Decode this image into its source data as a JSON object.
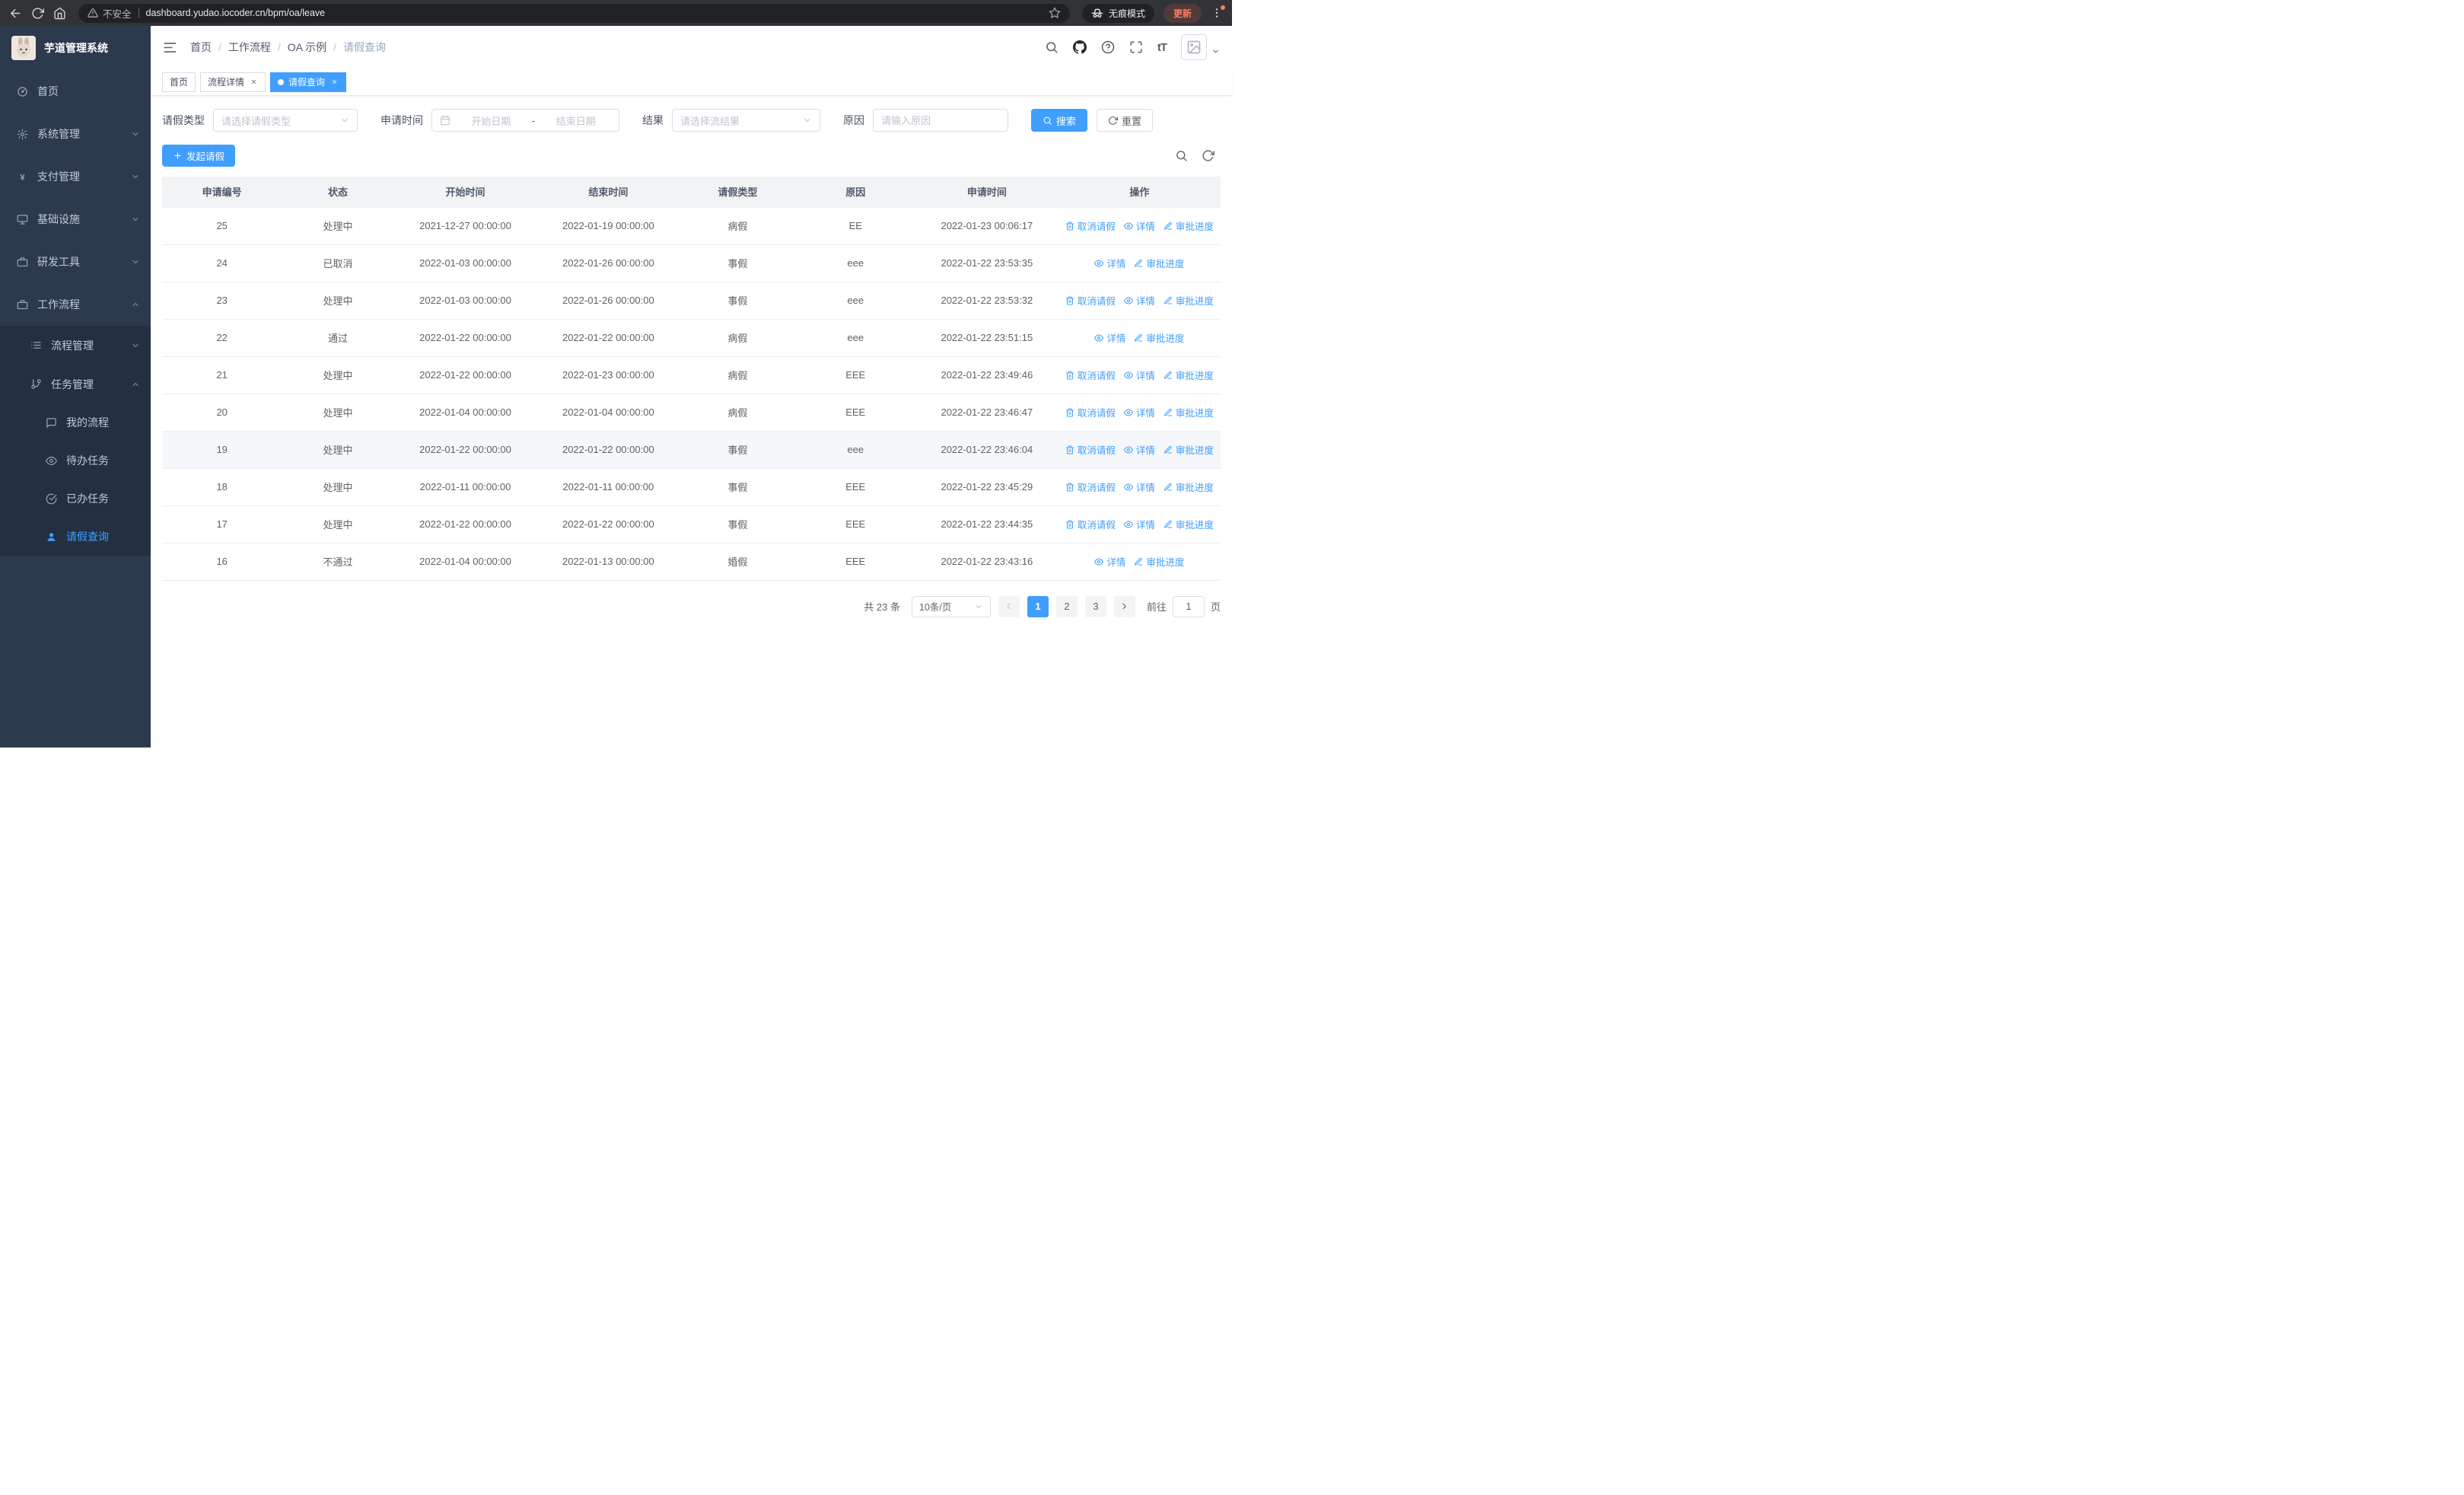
{
  "colors": {
    "primary": "#409eff",
    "sidebar_bg": "#2d3a4d",
    "submenu_bg": "#24303f",
    "link": "#409eff",
    "table_header_bg": "#f2f3f5",
    "chrome_bg": "#323337",
    "update_accent": "#ff7c65"
  },
  "browser": {
    "security_label": "不安全",
    "url": "dashboard.yudao.iocoder.cn/bpm/oa/leave",
    "incognito_label": "无痕模式",
    "update_label": "更新"
  },
  "sidebar": {
    "app_title": "芋道管理系统",
    "items": {
      "home": "首页",
      "system": "系统管理",
      "payment": "支付管理",
      "infra": "基础设施",
      "dev_tools": "研发工具",
      "workflow": "工作流程",
      "process_mgmt": "流程管理",
      "task_mgmt": "任务管理",
      "my_process": "我的流程",
      "todo_tasks": "待办任务",
      "done_tasks": "已办任务",
      "leave_query": "请假查询"
    }
  },
  "header": {
    "breadcrumb": [
      "首页",
      "工作流程",
      "OA 示例",
      "请假查询"
    ],
    "breadcrumb_separator": "/",
    "font_size_icon_text": "tT"
  },
  "tabs": [
    {
      "label": "首页"
    },
    {
      "label": "流程详情"
    },
    {
      "label": "请假查询"
    }
  ],
  "filters": {
    "leave_type_label": "请假类型",
    "leave_type_placeholder": "请选择请假类型",
    "apply_time_label": "申请时间",
    "start_date_placeholder": "开始日期",
    "range_separator": "-",
    "end_date_placeholder": "结束日期",
    "result_label": "结果",
    "result_placeholder": "请选择流结果",
    "reason_label": "原因",
    "reason_placeholder": "请输入原因",
    "search_button": "搜索",
    "reset_button": "重置"
  },
  "toolbar": {
    "create_button": "发起请假"
  },
  "table": {
    "columns": [
      "申请编号",
      "状态",
      "开始时间",
      "结束时间",
      "请假类型",
      "原因",
      "申请时间",
      "操作"
    ],
    "action_defs": {
      "cancel": {
        "label": "取消请假",
        "icon": "trash"
      },
      "detail": {
        "label": "详情",
        "icon": "eye"
      },
      "progress": {
        "label": "审批进度",
        "icon": "edit"
      }
    },
    "rows": [
      {
        "id": "25",
        "status": "处理中",
        "start_time": "2021-12-27 00:00:00",
        "end_time": "2022-01-19 00:00:00",
        "leave_type": "病假",
        "reason": "EE",
        "apply_time": "2022-01-23 00:06:17",
        "actions": [
          "cancel",
          "detail",
          "progress"
        ],
        "highlighted": false
      },
      {
        "id": "24",
        "status": "已取消",
        "start_time": "2022-01-03 00:00:00",
        "end_time": "2022-01-26 00:00:00",
        "leave_type": "事假",
        "reason": "eee",
        "apply_time": "2022-01-22 23:53:35",
        "actions": [
          "detail",
          "progress"
        ],
        "highlighted": false
      },
      {
        "id": "23",
        "status": "处理中",
        "start_time": "2022-01-03 00:00:00",
        "end_time": "2022-01-26 00:00:00",
        "leave_type": "事假",
        "reason": "eee",
        "apply_time": "2022-01-22 23:53:32",
        "actions": [
          "cancel",
          "detail",
          "progress"
        ],
        "highlighted": false
      },
      {
        "id": "22",
        "status": "通过",
        "start_time": "2022-01-22 00:00:00",
        "end_time": "2022-01-22 00:00:00",
        "leave_type": "病假",
        "reason": "eee",
        "apply_time": "2022-01-22 23:51:15",
        "actions": [
          "detail",
          "progress"
        ],
        "highlighted": false
      },
      {
        "id": "21",
        "status": "处理中",
        "start_time": "2022-01-22 00:00:00",
        "end_time": "2022-01-23 00:00:00",
        "leave_type": "病假",
        "reason": "EEE",
        "apply_time": "2022-01-22 23:49:46",
        "actions": [
          "cancel",
          "detail",
          "progress"
        ],
        "highlighted": false
      },
      {
        "id": "20",
        "status": "处理中",
        "start_time": "2022-01-04 00:00:00",
        "end_time": "2022-01-04 00:00:00",
        "leave_type": "病假",
        "reason": "EEE",
        "apply_time": "2022-01-22 23:46:47",
        "actions": [
          "cancel",
          "detail",
          "progress"
        ],
        "highlighted": false
      },
      {
        "id": "19",
        "status": "处理中",
        "start_time": "2022-01-22 00:00:00",
        "end_time": "2022-01-22 00:00:00",
        "leave_type": "事假",
        "reason": "eee",
        "apply_time": "2022-01-22 23:46:04",
        "actions": [
          "cancel",
          "detail",
          "progress"
        ],
        "highlighted": true
      },
      {
        "id": "18",
        "status": "处理中",
        "start_time": "2022-01-11 00:00:00",
        "end_time": "2022-01-11 00:00:00",
        "leave_type": "事假",
        "reason": "EEE",
        "apply_time": "2022-01-22 23:45:29",
        "actions": [
          "cancel",
          "detail",
          "progress"
        ],
        "highlighted": false
      },
      {
        "id": "17",
        "status": "处理中",
        "start_time": "2022-01-22 00:00:00",
        "end_time": "2022-01-22 00:00:00",
        "leave_type": "事假",
        "reason": "EEE",
        "apply_time": "2022-01-22 23:44:35",
        "actions": [
          "cancel",
          "detail",
          "progress"
        ],
        "highlighted": false
      },
      {
        "id": "16",
        "status": "不通过",
        "start_time": "2022-01-04 00:00:00",
        "end_time": "2022-01-13 00:00:00",
        "leave_type": "婚假",
        "reason": "EEE",
        "apply_time": "2022-01-22 23:43:16",
        "actions": [
          "detail",
          "progress"
        ],
        "highlighted": false
      }
    ]
  },
  "pagination": {
    "total_text": "共 23 条",
    "page_size": "10条/页",
    "pages": [
      "1",
      "2",
      "3"
    ],
    "active_page": "1",
    "goto_label": "前往",
    "goto_value": "1",
    "goto_unit": "页"
  }
}
